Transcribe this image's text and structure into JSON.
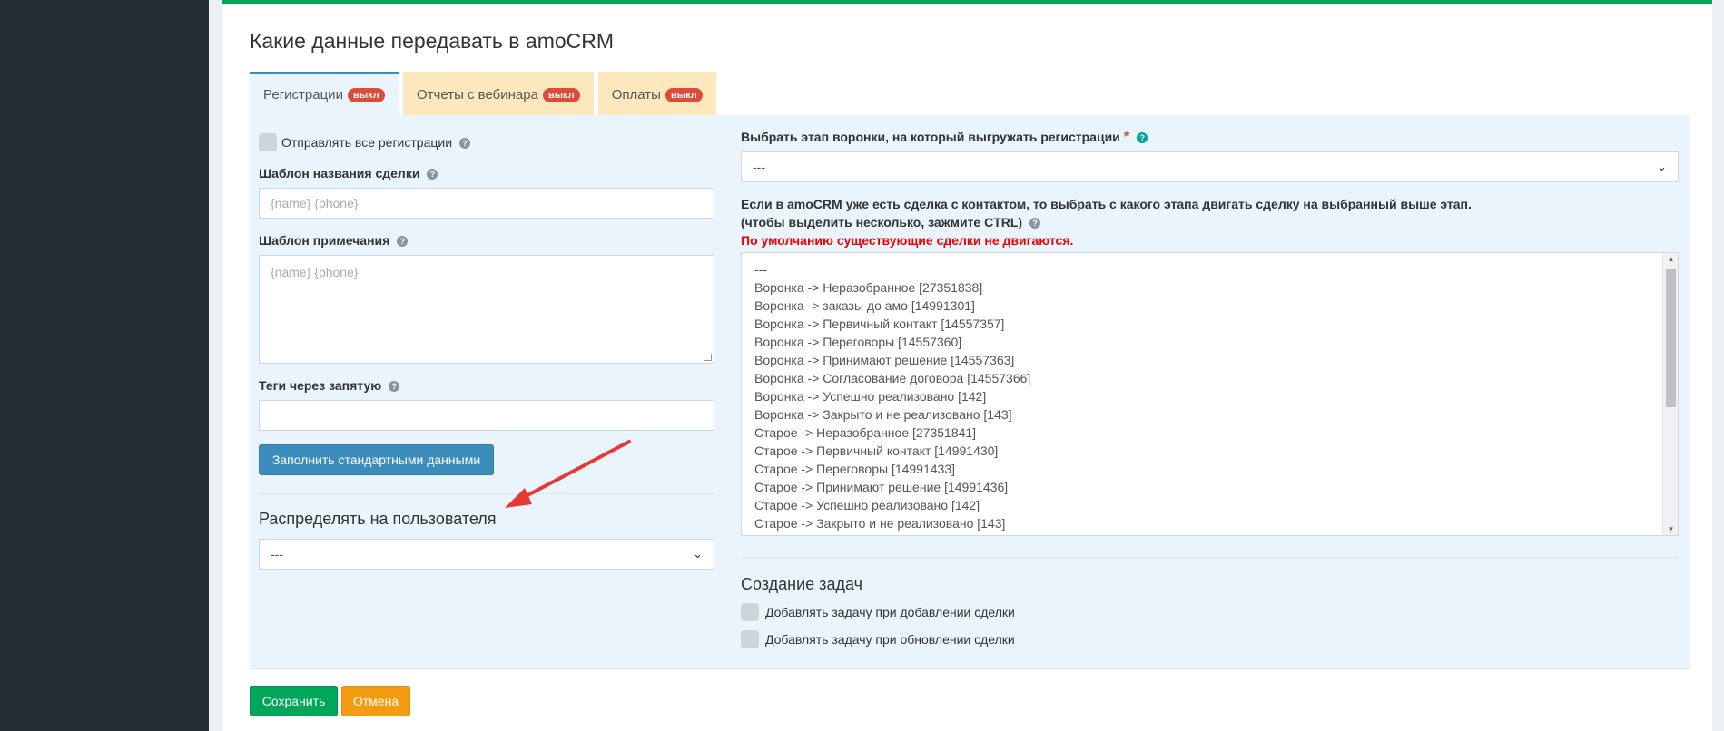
{
  "page": {
    "title": "Какие данные передавать в amoCRM"
  },
  "tabs": [
    {
      "label": "Регистрации",
      "badge": "выкл"
    },
    {
      "label": "Отчеты с вебинара",
      "badge": "выкл"
    },
    {
      "label": "Оплаты",
      "badge": "выкл"
    }
  ],
  "left": {
    "send_all_label": "Отправлять все регистрации",
    "deal_name_label": "Шаблон названия сделки",
    "deal_name_placeholder": "{name} {phone}",
    "note_label": "Шаблон примечания",
    "note_placeholder": "{name} {phone}",
    "tags_label": "Теги через запятую",
    "tags_value": "",
    "fill_button": "Заполнить стандартными данными",
    "distribute_title": "Распределять на пользователя",
    "distribute_value": "---"
  },
  "right": {
    "stage_label": "Выбрать этап воронки, на который выгружать регистрации",
    "stage_required": "*",
    "stage_value": "---",
    "move_info_line1": "Если в amoCRM уже есть сделка с контактом, то выбрать с какого этапа двигать сделку на выбранный выше этап.",
    "move_info_line2": "(чтобы выделить несколько, зажмите CTRL)",
    "move_note": "По умолчанию существующие сделки не двигаются.",
    "options": [
      "---",
      "Воронка -> Неразобранное [27351838]",
      "Воронка -> заказы до амо [14991301]",
      "Воронка -> Первичный контакт [14557357]",
      "Воронка -> Переговоры [14557360]",
      "Воронка -> Принимают решение [14557363]",
      "Воронка -> Согласование договора [14557366]",
      "Воронка -> Успешно реализовано [142]",
      "Воронка -> Закрыто и не реализовано [143]",
      "Старое -> Неразобранное [27351841]",
      "Старое -> Первичный контакт [14991430]",
      "Старое -> Переговоры [14991433]",
      "Старое -> Принимают решение [14991436]",
      "Старое -> Успешно реализовано [142]",
      "Старое -> Закрыто и не реализовано [143]"
    ],
    "tasks_title": "Создание задач",
    "task_on_add": "Добавлять задачу при добавлении сделки",
    "task_on_update": "Добавлять задачу при обновлении сделки"
  },
  "footer": {
    "save": "Сохранить",
    "cancel": "Отмена"
  },
  "icons": {
    "help": "?",
    "chevron": "⌄",
    "scroll_up": "▲",
    "scroll_down": "▼"
  },
  "colors": {
    "accent": "#3c8dbc",
    "success": "#00a65a",
    "warning": "#f39c12",
    "danger": "#dd4b39",
    "annotation": "#e53935"
  }
}
